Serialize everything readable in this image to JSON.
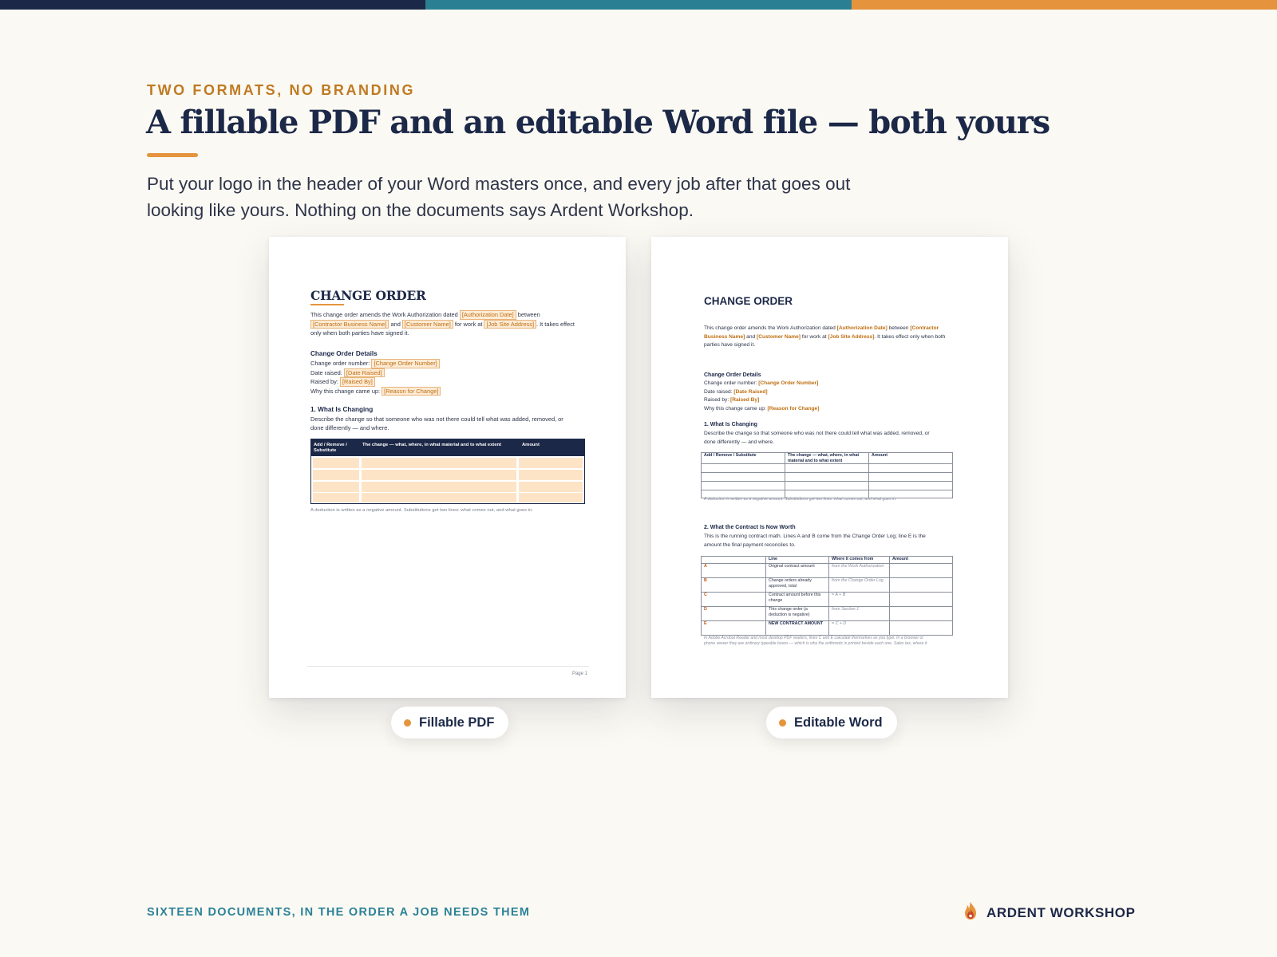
{
  "colors": {
    "navy": "#1c2848",
    "teal": "#2b7f93",
    "orange": "#e5943d",
    "background": "#fbf9f3"
  },
  "top_bar": [
    "#1c2848",
    "#2b7f93",
    "#e5943d"
  ],
  "eyebrow": "TWO FORMATS, NO BRANDING",
  "headline": "A fillable PDF and an editable Word file — both yours",
  "lede": "Put your logo in the header of your Word masters once, and every job after that goes out looking like yours. Nothing on the documents says Ardent Workshop.",
  "pdf": {
    "label": "Fillable PDF",
    "title": "CHANGE ORDER",
    "intro": {
      "a": "This change order amends the Work Authorization dated",
      "f1": "[Authorization Date]",
      "b": "between",
      "f2": "[Contractor Business Name]",
      "c": "and",
      "f3": "[Customer Name]",
      "d": "for work at",
      "f4": "[Job Site Address]",
      "e": ". It takes effect",
      "g": "only when both parties have signed it."
    },
    "details_heading": "Change Order Details",
    "details": [
      {
        "label": "Change order number:",
        "field": "[Change Order Number]"
      },
      {
        "label": "Date raised:",
        "field": "[Date Raised]"
      },
      {
        "label": "Raised by:",
        "field": "[Raised By]"
      },
      {
        "label": "Why this change came up:",
        "field": "[Reason for Change]"
      }
    ],
    "section1_heading": "1. What Is Changing",
    "section1_text1": "Describe the change so that someone who was not there could tell what was added, removed, or",
    "section1_text2": "done differently — and where.",
    "table_headers": [
      "Add / Remove / Substitute",
      "The change — what, where, in what material and to what extent",
      "Amount"
    ],
    "caption": "A deduction is written as a negative amount. Substitutions get two lines: what comes out, and what goes in.",
    "page": "Page 1"
  },
  "word": {
    "label": "Editable Word",
    "title": "CHANGE ORDER",
    "intro": {
      "a": "This change order amends the Work Authorization dated",
      "f1": "[Authorization Date]",
      "b": "between",
      "f2a": "[Contractor",
      "f2b": "Business Name]",
      "c": "and",
      "f3": "[Customer Name]",
      "d": "for work at",
      "f4": "[Job Site Address]",
      "e": ". It takes effect only when both",
      "g": "parties have signed it."
    },
    "details_heading": "Change Order Details",
    "details": [
      {
        "label": "Change order number:",
        "field": "[Change Order Number]"
      },
      {
        "label": "Date raised:",
        "field": "[Date Raised]"
      },
      {
        "label": "Raised by:",
        "field": "[Raised By]"
      },
      {
        "label": "Why this change came up:",
        "field": "[Reason for Change]"
      }
    ],
    "section1_heading": "1. What Is Changing",
    "section1_text1": "Describe the change so that someone who was not there could tell what was added, removed, or",
    "section1_text2": "done differently — and where.",
    "table1_headers": [
      "Add / Remove / Substitute",
      "The change — what, where, in what material and to what extent",
      "Amount"
    ],
    "caption1": "A deduction is written as a negative amount. Substitutions get two lines: what comes out, and what goes in.",
    "section2_heading": "2. What the Contract Is Now Worth",
    "section2_text1": "This is the running contract math. Lines A and B come from the Change Order Log; line E is the",
    "section2_text2": "amount the final payment reconciles to.",
    "table2_headers": [
      "",
      "Line",
      "Where it comes from",
      "Amount"
    ],
    "table2_rows": [
      {
        "letter": "A",
        "line": "Original contract amount",
        "source": "from the Work Authorization"
      },
      {
        "letter": "B",
        "line": "Change orders already approved, total",
        "source": "from the Change Order Log"
      },
      {
        "letter": "C",
        "line": "Contract amount before this change",
        "source": "= A + B"
      },
      {
        "letter": "D",
        "line": "This change order (a deduction is negative)",
        "source": "from Section 1"
      },
      {
        "letter": "E",
        "line": "NEW CONTRACT AMOUNT",
        "source": "= C + D"
      }
    ],
    "caption2a": "In Adobe Acrobat Reader and most desktop PDF readers, lines C and E calculate themselves as you type. In a browser or",
    "caption2b": "phone viewer they are ordinary typeable boxes — which is why the arithmetic is printed beside each one. Sales tax, where it"
  },
  "footer": {
    "tagline": "SIXTEEN DOCUMENTS, IN THE ORDER A JOB NEEDS THEM",
    "brand": "ARDENT WORKSHOP",
    "brand_icon": "flame-icon"
  }
}
